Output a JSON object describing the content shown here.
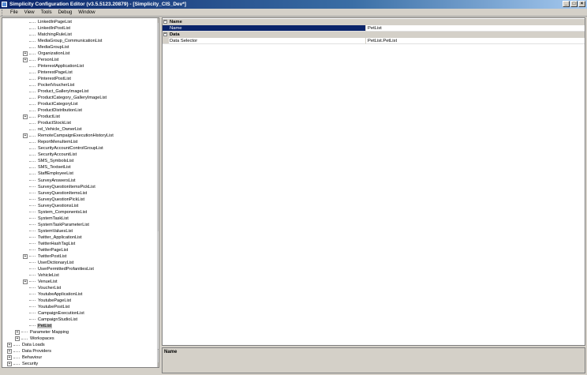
{
  "window": {
    "title": "Simplicity Configuration Editor (v3.5.5123.20879) - [Simplicity_CIS_Dev*]",
    "minimize": "_",
    "maximize": "□",
    "close": "×"
  },
  "menu": [
    "File",
    "View",
    "Tools",
    "Debug",
    "Window"
  ],
  "tree": [
    {
      "label": "LinkedInPageList",
      "level": 3,
      "expander": false
    },
    {
      "label": "LinkedInPostList",
      "level": 3,
      "expander": false
    },
    {
      "label": "MatchingRuleList",
      "level": 3,
      "expander": false
    },
    {
      "label": "MediaGroup_CommunicationList",
      "level": 3,
      "expander": false
    },
    {
      "label": "MediaGroupList",
      "level": 3,
      "expander": false
    },
    {
      "label": "OrganizationList",
      "level": 3,
      "expander": true
    },
    {
      "label": "PersonList",
      "level": 3,
      "expander": true
    },
    {
      "label": "PinterestApplicationList",
      "level": 3,
      "expander": false
    },
    {
      "label": "PinterestPageList",
      "level": 3,
      "expander": false
    },
    {
      "label": "PinterestPostList",
      "level": 3,
      "expander": false
    },
    {
      "label": "PocketVoucherList",
      "level": 3,
      "expander": false
    },
    {
      "label": "Product_GalleryImageList",
      "level": 3,
      "expander": false
    },
    {
      "label": "ProductCategory_GalleryImageList",
      "level": 3,
      "expander": false
    },
    {
      "label": "ProductCategoryList",
      "level": 3,
      "expander": false
    },
    {
      "label": "ProductDistributionList",
      "level": 3,
      "expander": false
    },
    {
      "label": "ProductList",
      "level": 3,
      "expander": true
    },
    {
      "label": "ProductStockList",
      "level": 3,
      "expander": false
    },
    {
      "label": "rel_Vehicle_OwnerList",
      "level": 3,
      "expander": false
    },
    {
      "label": "RemoteCampaignExecutionHistoryList",
      "level": 3,
      "expander": true
    },
    {
      "label": "ReportMenuItemList",
      "level": 3,
      "expander": false
    },
    {
      "label": "SecurityAccountControlGroupList",
      "level": 3,
      "expander": false
    },
    {
      "label": "SecurityAccountList",
      "level": 3,
      "expander": false
    },
    {
      "label": "SMS_SymbolsList",
      "level": 3,
      "expander": false
    },
    {
      "label": "SMS_TextsetList",
      "level": 3,
      "expander": false
    },
    {
      "label": "StaffEmployeeList",
      "level": 3,
      "expander": false
    },
    {
      "label": "SurveyAnswersList",
      "level": 3,
      "expander": false
    },
    {
      "label": "SurveyQuestionItemsPickList",
      "level": 3,
      "expander": false
    },
    {
      "label": "SurveyQuestionItemsList",
      "level": 3,
      "expander": false
    },
    {
      "label": "SurveyQuestionPickList",
      "level": 3,
      "expander": false
    },
    {
      "label": "SurveyQuestionsList",
      "level": 3,
      "expander": false
    },
    {
      "label": "System_ComponentsList",
      "level": 3,
      "expander": false
    },
    {
      "label": "SystemTaskList",
      "level": 3,
      "expander": false
    },
    {
      "label": "SystemTaskParameterList",
      "level": 3,
      "expander": false
    },
    {
      "label": "SystemValuesList",
      "level": 3,
      "expander": false
    },
    {
      "label": "Twitter_ApplicationList",
      "level": 3,
      "expander": false
    },
    {
      "label": "TwitterHashTagList",
      "level": 3,
      "expander": false
    },
    {
      "label": "TwitterPageList",
      "level": 3,
      "expander": false
    },
    {
      "label": "TwitterPostList",
      "level": 3,
      "expander": true
    },
    {
      "label": "UserDictionaryList",
      "level": 3,
      "expander": false
    },
    {
      "label": "UserPermittedProfanitiesList",
      "level": 3,
      "expander": false
    },
    {
      "label": "VehicleList",
      "level": 3,
      "expander": false
    },
    {
      "label": "VenueList",
      "level": 3,
      "expander": true
    },
    {
      "label": "VoucherList",
      "level": 3,
      "expander": false
    },
    {
      "label": "YoutubeApplicationList",
      "level": 3,
      "expander": false
    },
    {
      "label": "YoutubePageList",
      "level": 3,
      "expander": false
    },
    {
      "label": "YoutubePostList",
      "level": 3,
      "expander": false
    },
    {
      "label": "CampaignExecutionList",
      "level": 3,
      "expander": false
    },
    {
      "label": "CampaignStudioList",
      "level": 3,
      "expander": false
    },
    {
      "label": "PetList",
      "level": 3,
      "expander": false,
      "selected": true
    },
    {
      "label": "Parameter Mapping",
      "level": 2,
      "expander": true
    },
    {
      "label": "Workspaces",
      "level": 2,
      "expander": true
    },
    {
      "label": "Data Loads",
      "level": 1,
      "expander": true
    },
    {
      "label": "Data Providers",
      "level": 1,
      "expander": true
    },
    {
      "label": "Behaviour",
      "level": 1,
      "expander": true
    },
    {
      "label": "Security",
      "level": 1,
      "expander": true
    }
  ],
  "properties": {
    "categories": [
      {
        "label": "Name",
        "toggle": "−",
        "rows": [
          {
            "name": "Name",
            "value": "PetList",
            "selected": true
          }
        ]
      },
      {
        "label": "Data",
        "toggle": "−",
        "rows": [
          {
            "name": "Data Selector",
            "value": "PetList.PetList",
            "selected": false
          }
        ]
      }
    ]
  },
  "description": {
    "title": "Name"
  },
  "colors": {
    "selection": "#0a246a",
    "title_gradient_start": "#0a246a",
    "title_gradient_end": "#a6caf0"
  }
}
